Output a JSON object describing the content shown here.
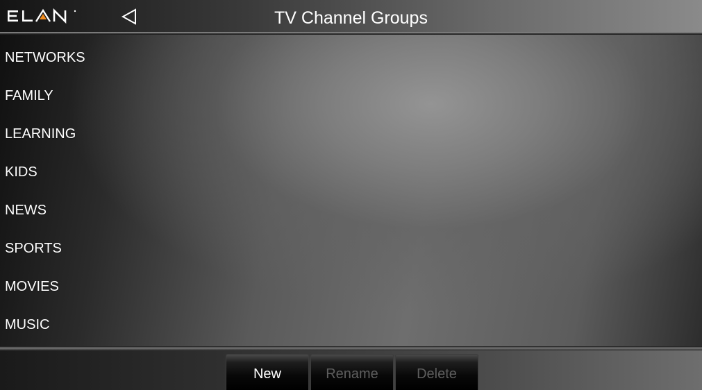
{
  "brand": {
    "logo_text": "ELAN",
    "accent_color": "#f28c1e"
  },
  "header": {
    "title": "TV Channel Groups",
    "back_icon": "triangle-left-outline-icon"
  },
  "groups": [
    {
      "label": "NETWORKS"
    },
    {
      "label": "FAMILY"
    },
    {
      "label": "LEARNING"
    },
    {
      "label": "KIDS"
    },
    {
      "label": "NEWS"
    },
    {
      "label": "SPORTS"
    },
    {
      "label": "MOVIES"
    },
    {
      "label": "MUSIC"
    }
  ],
  "toolbar": {
    "new_label": "New",
    "rename_label": "Rename",
    "delete_label": "Delete",
    "rename_enabled": false,
    "delete_enabled": false
  }
}
